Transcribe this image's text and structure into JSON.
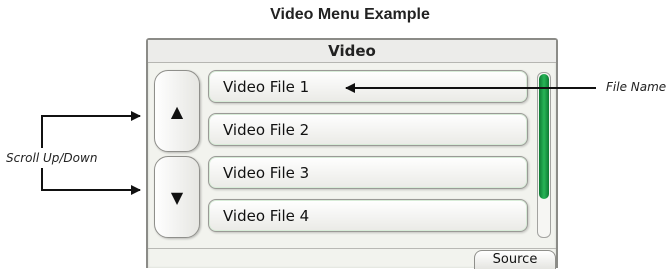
{
  "diagram": {
    "title": "Video Menu Example"
  },
  "screen": {
    "header": "Video",
    "up_glyph": "▲",
    "down_glyph": "▼",
    "files": [
      "Video File 1",
      "Video File 2",
      "Video File 3",
      "Video File 4"
    ],
    "source_label": "Source",
    "scroll_thumb_fraction": 0.77,
    "accent_color": "#1f9e48"
  },
  "annotations": {
    "file_name": "File Name",
    "scroll": "Scroll Up/Down"
  }
}
